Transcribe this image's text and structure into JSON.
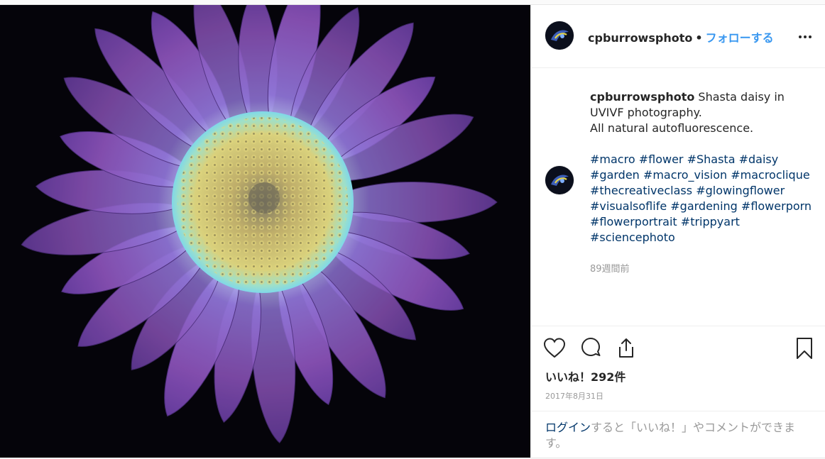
{
  "header": {
    "username": "cpburrowsphoto",
    "separator": "•",
    "follow_label": "フォローする",
    "more_icon": "more-dots-icon"
  },
  "caption": {
    "username": "cpburrowsphoto",
    "line1": " Shasta daisy in",
    "line2": "UVIVF photography.",
    "line3": "All natural autofluorescence."
  },
  "hashtags": [
    "#macro",
    "#flower",
    "#Shasta",
    "#daisy",
    "#garden",
    "#macro_vision",
    "#macroclique",
    "#thecreativeclass",
    "#glowingflower",
    "#visualsoflife",
    "#gardening",
    "#flowerporn",
    "#flowerportrait",
    "#trippyart",
    "#sciencephoto"
  ],
  "comment_age": "89週間前",
  "actions": {
    "like_icon": "heart-icon",
    "comment_icon": "comment-bubble-icon",
    "share_icon": "share-icon",
    "save_icon": "bookmark-icon"
  },
  "likes_text": "いいね！292件",
  "post_date": "2017年8月31日",
  "login_prompt": {
    "link": "ログイン",
    "rest": "すると「いいね！」やコメントができます。"
  },
  "colors": {
    "accent": "#3897f0",
    "hashtag": "#003569",
    "muted": "#999999"
  }
}
